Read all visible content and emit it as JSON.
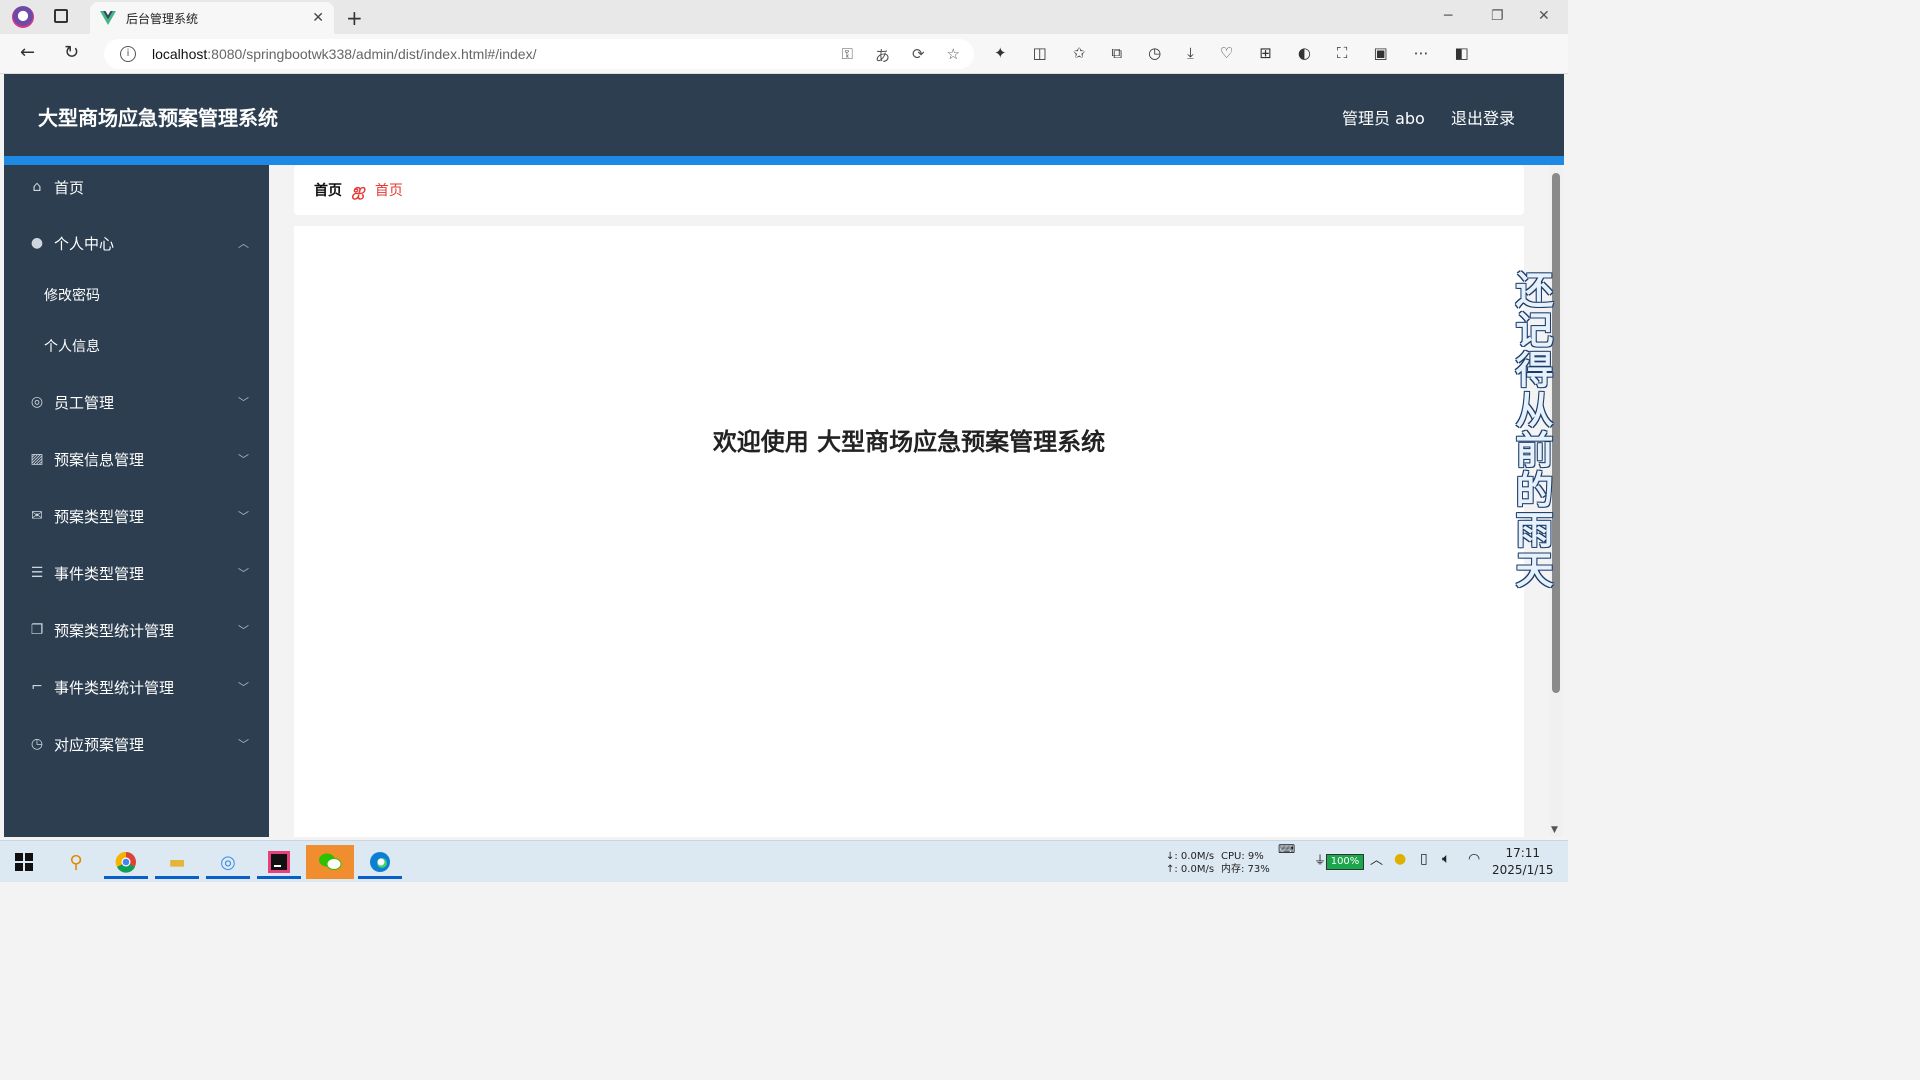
{
  "browser": {
    "tab_title": "后台管理系统",
    "tab_close": "✕",
    "new_tab": "+",
    "url_host": "localhost",
    "url_rest": ":8080/springbootwk338/admin/dist/index.html#/index/",
    "info_icon": "i"
  },
  "app": {
    "title": "大型商场应急预案管理系统",
    "user": "管理员 abo",
    "logout": "退出登录"
  },
  "sidebar": {
    "items": [
      {
        "label": "首页",
        "icon": "home-icon"
      },
      {
        "label": "个人中心",
        "icon": "user-icon"
      },
      {
        "label": "员工管理",
        "icon": "staff-icon"
      },
      {
        "label": "预案信息管理",
        "icon": "chart-icon"
      },
      {
        "label": "预案类型管理",
        "icon": "mail-icon"
      },
      {
        "label": "事件类型管理",
        "icon": "list-icon"
      },
      {
        "label": "预案类型统计管理",
        "icon": "copy-icon"
      },
      {
        "label": "事件类型统计管理",
        "icon": "crop-icon"
      },
      {
        "label": "对应预案管理",
        "icon": "clock-icon"
      }
    ],
    "submenu": [
      "修改密码",
      "个人信息"
    ]
  },
  "breadcrumb": {
    "home": "首页",
    "separator": "ஐ",
    "current": "首页"
  },
  "main": {
    "welcome": "欢迎使用 大型商场应急预案管理系统"
  },
  "overlay": {
    "vertical_text": "还记得从前的雨天"
  },
  "taskbar": {
    "net_down": "↓: 0.0M/s",
    "net_up": "↑: 0.0M/s",
    "cpu": "CPU: 9%",
    "mem": "内存: 73%",
    "battery": "100%",
    "time": "17:11",
    "date": "2025/1/15"
  },
  "colors": {
    "header_bg": "#2c3e50",
    "accent_bar": "#1e88e5",
    "breadcrumb_red": "#e53935"
  }
}
